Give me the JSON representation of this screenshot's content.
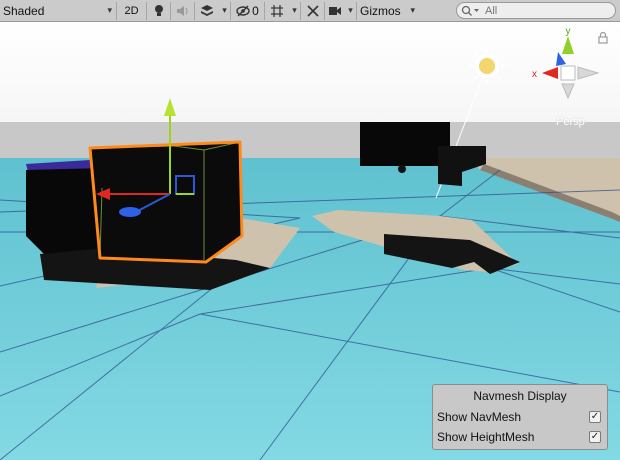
{
  "toolbar": {
    "shading_mode": "Shaded",
    "mode_2d": "2D",
    "hidden_count": "0",
    "gizmos_label": "Gizmos",
    "caret": "▾",
    "lightbulb_icon": "lightbulb-icon",
    "audio_icon": "audio-icon",
    "effects_icon": "effects-icon",
    "hidden_objects_icon": "eye-slash-icon",
    "grid_icon": "grid-icon",
    "tools_icon": "tools-icon",
    "camera_icon": "camera-icon"
  },
  "search": {
    "placeholder": "All",
    "icon": "search-icon"
  },
  "scene": {
    "orientation_label": "Persp",
    "sky_color": "#f9f9f9",
    "ground_color": "#78d3df",
    "selection_color": "#ff8a1c"
  },
  "navmesh_panel": {
    "title": "Navmesh Display",
    "options": [
      {
        "label": "Show NavMesh",
        "checked": true
      },
      {
        "label": "Show HeightMesh",
        "checked": true
      }
    ],
    "check_glyph": "✓"
  }
}
